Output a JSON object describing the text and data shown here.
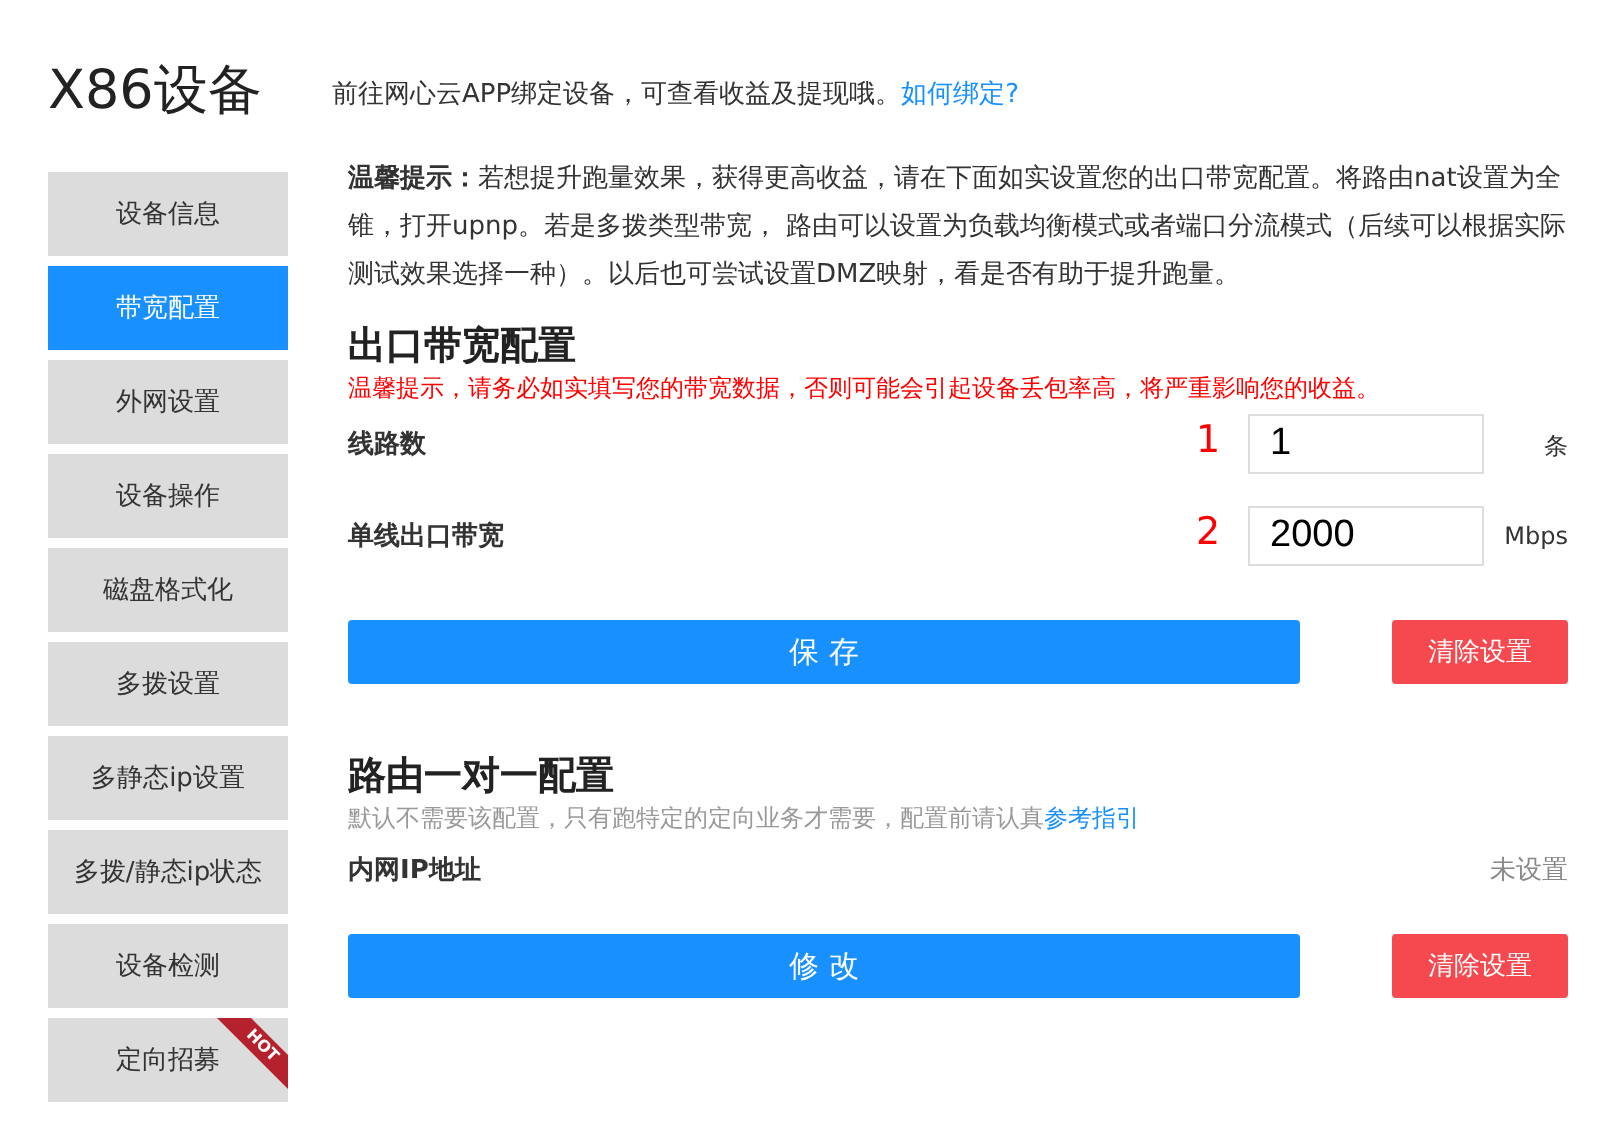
{
  "title": "X86设备",
  "sidebar": {
    "items": [
      {
        "label": "设备信息",
        "selected": false
      },
      {
        "label": "带宽配置",
        "selected": true
      },
      {
        "label": "外网设置",
        "selected": false
      },
      {
        "label": "设备操作",
        "selected": false
      },
      {
        "label": "磁盘格式化",
        "selected": false
      },
      {
        "label": "多拨设置",
        "selected": false
      },
      {
        "label": "多静态ip设置",
        "selected": false
      },
      {
        "label": "多拨/静态ip状态",
        "selected": false
      },
      {
        "label": "设备检测",
        "selected": false
      },
      {
        "label": "定向招募",
        "selected": false,
        "badge": "HOT"
      }
    ]
  },
  "intro": {
    "text": "前往网心云APP绑定设备，可查看收益及提现哦。",
    "link": "如何绑定?"
  },
  "tip": "**温馨提示：**若想提升跑量效果，获得更高收益，请在下面如实设置您的出口带宽配置。将路由nat设置为全锥，打开upnp。若是多拨类型带宽， 路由可以设置为负载均衡模式或者端口分流模式（后续可以根据实际测试效果选择一种）。以后也可尝试设置DMZ映射，看是否有助于提升跑量。",
  "bandwidth": {
    "heading": "出口带宽配置",
    "warning": "温馨提示，请务必如实填写您的带宽数据，否则可能会引起设备丢包率高，将严重影响您的收益。",
    "fields": [
      {
        "label": "线路数",
        "marker": "1",
        "value": "1",
        "unit": "条"
      },
      {
        "label": "单线出口带宽",
        "marker": "2",
        "value": "2000",
        "unit": "Mbps"
      }
    ],
    "primary_button": "保 存",
    "clear_button": "清除设置"
  },
  "routing": {
    "heading": "路由一对一配置",
    "description": "默认不需要该配置，只有跑特定的定向业务才需要，配置前请认真",
    "link": "参考指引",
    "rows": [
      {
        "label": "内网IP地址",
        "value": "未设置"
      }
    ],
    "primary_button": "修 改",
    "clear_button": "清除设置"
  }
}
